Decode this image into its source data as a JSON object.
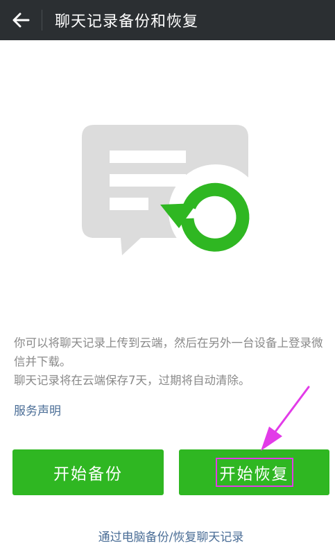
{
  "header": {
    "title": "聊天记录备份和恢复",
    "back_icon": "arrow-left-icon"
  },
  "illustration": {
    "icon": "chat-restore-icon",
    "bubble_color": "#dcdcdc",
    "accent_color": "#2fb722"
  },
  "main": {
    "description_line1": "你可以将聊天记录上传到云端，然后在另外一台设备上登录微信并下载。",
    "description_line2": "聊天记录将在云端保存7天，过期将自动清除。",
    "service_link": "服务声明",
    "backup_button": "开始备份",
    "restore_button": "开始恢复",
    "pc_link": "通过电脑备份/恢复聊天记录"
  },
  "colors": {
    "header_bg": "#2b2f32",
    "button_green": "#2fb722",
    "link_blue": "#4a6d96",
    "highlight_magenta": "#e23be8"
  }
}
